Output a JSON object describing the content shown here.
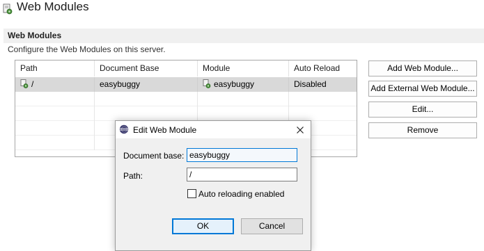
{
  "header": {
    "title": "Web Modules",
    "icon": "server-module-icon"
  },
  "section": {
    "title": "Web Modules",
    "description": "Configure the Web Modules on this server."
  },
  "table": {
    "columns": [
      "Path",
      "Document Base",
      "Module",
      "Auto Reload"
    ],
    "rows": [
      {
        "path": "/",
        "document_base": "easybuggy",
        "module": "easybuggy",
        "auto_reload": "Disabled",
        "selected": true
      }
    ]
  },
  "side_buttons": {
    "add_web_module": "Add Web Module...",
    "add_external_web_module": "Add External Web Module...",
    "edit": "Edit...",
    "remove": "Remove"
  },
  "dialog": {
    "title": "Edit Web Module",
    "icon": "eclipse-icon",
    "document_base_label": "Document base:",
    "document_base_value": "easybuggy",
    "path_label": "Path:",
    "path_value": "/",
    "auto_reload_label": "Auto reloading enabled",
    "auto_reload_checked": false,
    "ok_label": "OK",
    "cancel_label": "Cancel"
  },
  "colors": {
    "selected_row": "#d9d9d9",
    "focus_blue": "#0078d7",
    "section_band": "#f0f0f0"
  }
}
